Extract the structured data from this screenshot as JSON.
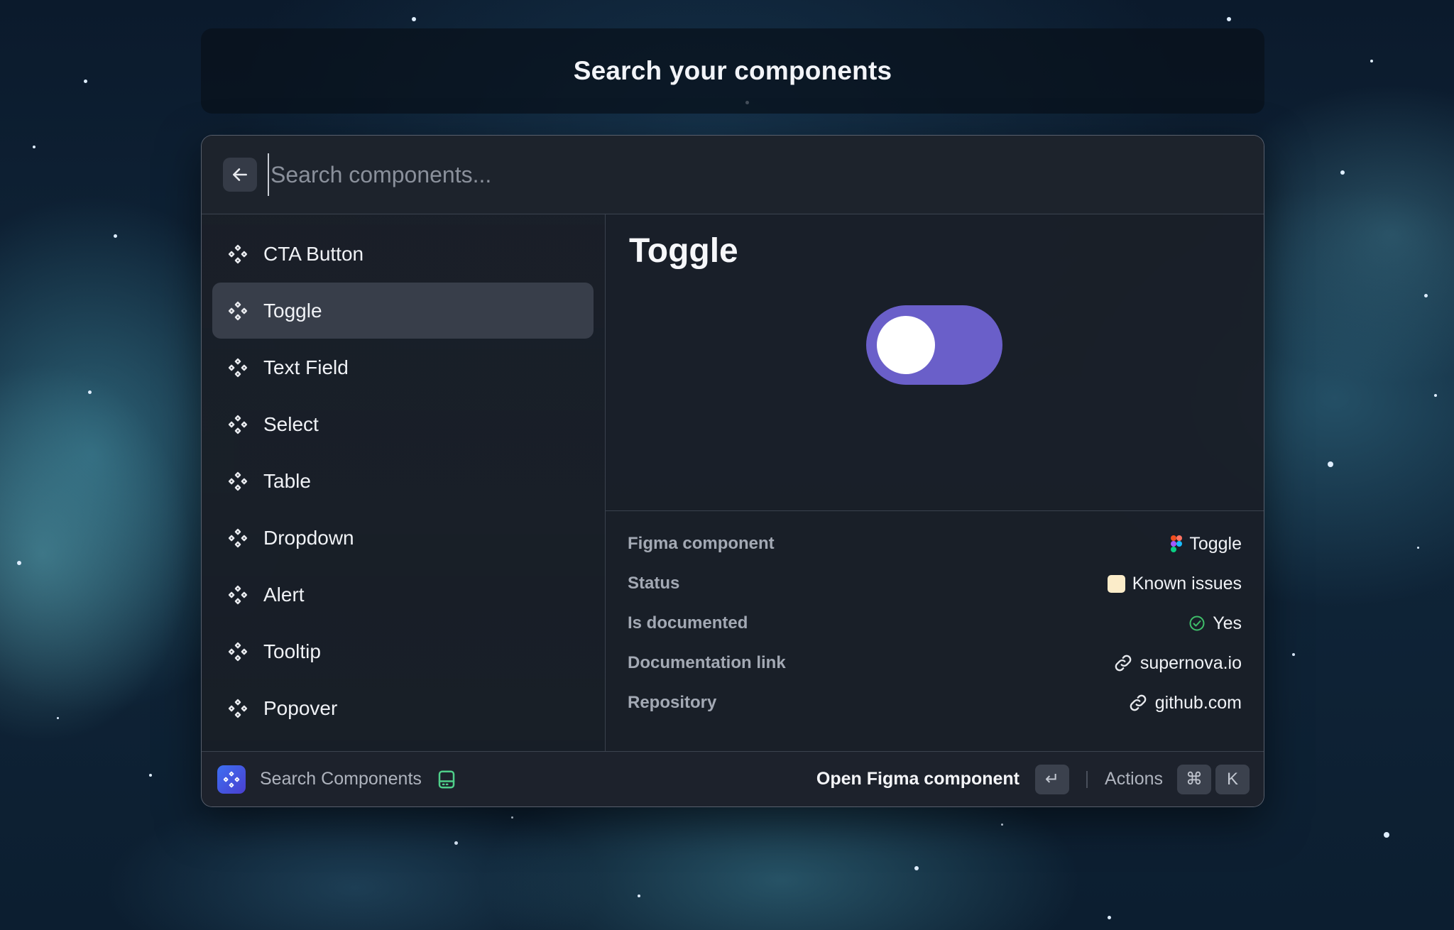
{
  "page": {
    "title": "Search your components"
  },
  "search": {
    "placeholder": "Search components..."
  },
  "components": [
    {
      "label": "CTA Button",
      "selected": false
    },
    {
      "label": "Toggle",
      "selected": true
    },
    {
      "label": "Text Field",
      "selected": false
    },
    {
      "label": "Select",
      "selected": false
    },
    {
      "label": "Table",
      "selected": false
    },
    {
      "label": "Dropdown",
      "selected": false
    },
    {
      "label": "Alert",
      "selected": false
    },
    {
      "label": "Tooltip",
      "selected": false
    },
    {
      "label": "Popover",
      "selected": false
    }
  ],
  "detail": {
    "title": "Toggle",
    "toggle_color": "#6a5fc9",
    "metadata": [
      {
        "key": "Figma component",
        "icon": "figma-icon",
        "value": "Toggle"
      },
      {
        "key": "Status",
        "icon": "status-swatch",
        "value": "Known issues",
        "color": "#fbecc9"
      },
      {
        "key": "Is documented",
        "icon": "check-circle-icon",
        "value": "Yes",
        "color": "#3fbf6a"
      },
      {
        "key": "Documentation link",
        "icon": "link-icon",
        "value": "supernova.io"
      },
      {
        "key": "Repository",
        "icon": "link-icon",
        "value": "github.com"
      }
    ]
  },
  "footer": {
    "app_name": "Search Components",
    "primary_action": "Open Figma component",
    "primary_key": "↵",
    "actions_label": "Actions",
    "actions_keys": [
      "⌘",
      "K"
    ]
  }
}
